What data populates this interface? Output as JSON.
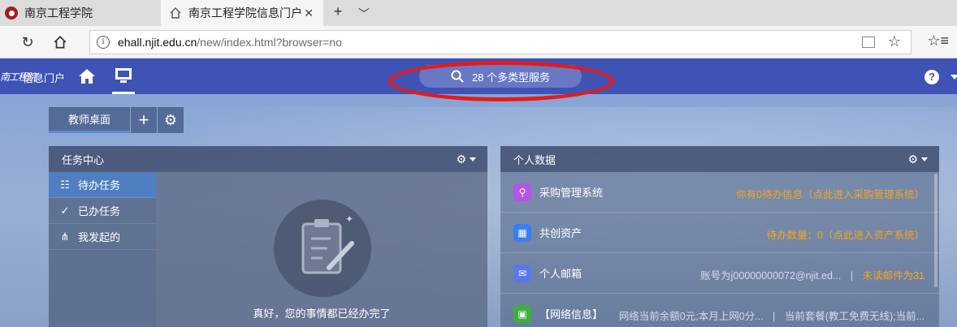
{
  "browser": {
    "tabs": [
      {
        "title": "南京工程学院",
        "active": false
      },
      {
        "title": "南京工程学院信息门户",
        "active": true
      }
    ],
    "url_host": "ehall.njit.edu.cn",
    "url_path": "/new/index.html?browser=no"
  },
  "portal": {
    "logo_text": "信息门户",
    "logo_mark": "南工程院",
    "search_label": "28 个多类型服务",
    "help": "?",
    "desk_tab": "教师桌面"
  },
  "task_center": {
    "title": "任务中心",
    "menu": [
      "待办任务",
      "已办任务",
      "我发起的"
    ],
    "empty_text": "真好，您的事情都已经办完了"
  },
  "personal_data": {
    "title": "个人数据",
    "rows": [
      {
        "name": "采购管理系统",
        "info": "你有0待办信息（点此进入采购管理系统）",
        "icon_color": "#b455e3"
      },
      {
        "name": "共创资产",
        "info": "待办数量：0（点此进入资产系统）",
        "icon_color": "#3a7ef0"
      },
      {
        "name": "个人邮箱",
        "info": "账号为j00000000072@njit.ed...",
        "sep": "|",
        "info2": "未读邮件为31",
        "icon_color": "#5b78e8"
      },
      {
        "name": "【网络信息】",
        "info": "网络当前余额0元;本月上网0分...",
        "sep": "|",
        "info2": "当前套餐(教工免费无线);当前...",
        "icon_color": "#3fae3f"
      }
    ]
  },
  "colors": {
    "nav": "#3f53b5",
    "highlight": "#e41b1b",
    "orange": "#f5a623"
  }
}
